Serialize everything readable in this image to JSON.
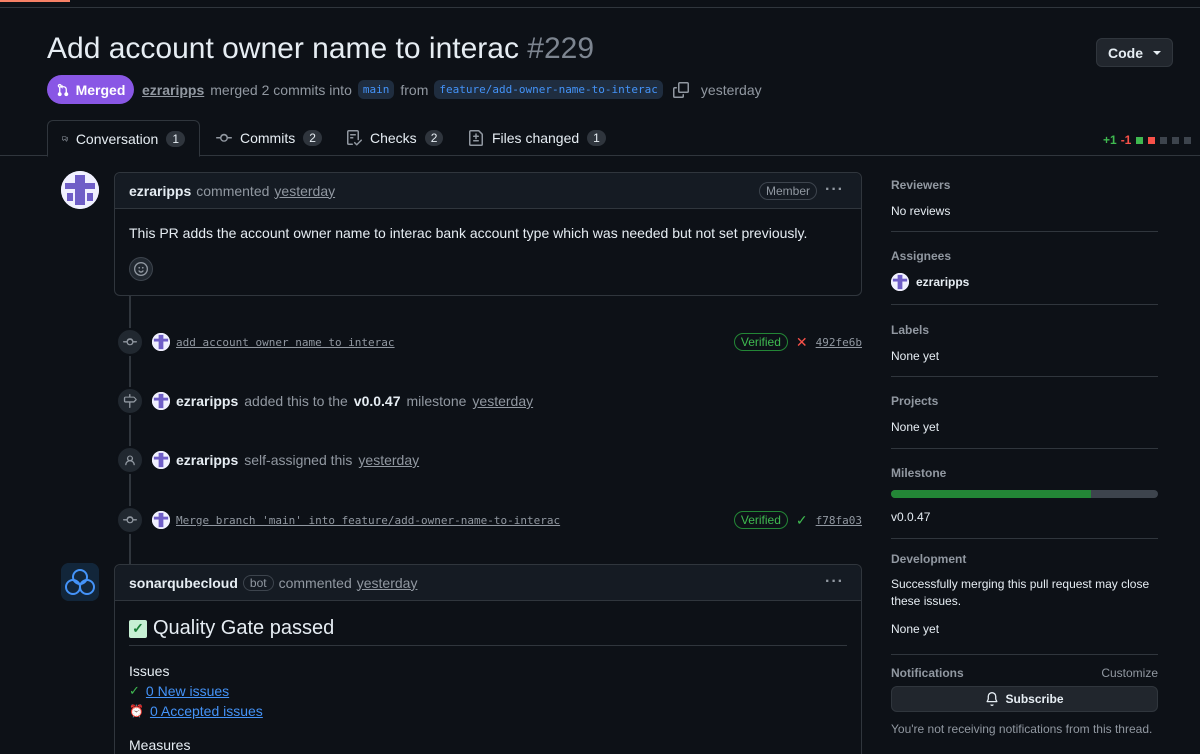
{
  "pr": {
    "title": "Add account owner name to interac",
    "number": "#229",
    "code_button": "Code",
    "status": "Merged",
    "author": "ezraripps",
    "merge_text": "merged 2 commits into",
    "base_branch": "main",
    "from_text": "from",
    "head_branch": "feature/add-owner-name-to-interac",
    "time": "yesterday"
  },
  "tabs": [
    {
      "label": "Conversation",
      "count": "1"
    },
    {
      "label": "Commits",
      "count": "2"
    },
    {
      "label": "Checks",
      "count": "2"
    },
    {
      "label": "Files changed",
      "count": "1"
    }
  ],
  "diffstat": {
    "additions": "+1",
    "deletions": "-1"
  },
  "comment1": {
    "author": "ezraripps",
    "action": "commented",
    "time": "yesterday",
    "badge": "Member",
    "body": "This PR adds the account owner name to interac bank account type which was needed but not set previously."
  },
  "events": {
    "commit1": {
      "message": "add account owner name to interac",
      "verified": "Verified",
      "sha": "492fe6b"
    },
    "milestone": {
      "author": "ezraripps",
      "text": "added this to the",
      "milestone": "v0.0.47",
      "suffix": "milestone",
      "time": "yesterday"
    },
    "assign": {
      "author": "ezraripps",
      "text": "self-assigned this",
      "time": "yesterday"
    },
    "commit2": {
      "message": "Merge branch 'main' into feature/add-owner-name-to-interac",
      "verified": "Verified",
      "sha": "f78fa03"
    }
  },
  "comment2": {
    "author": "sonarqubecloud",
    "badge": "bot",
    "action": "commented",
    "time": "yesterday",
    "heading": "Quality Gate passed",
    "issues_label": "Issues",
    "new_issues": "0 New issues",
    "accepted_issues": "0 Accepted issues",
    "measures_label": "Measures"
  },
  "sidebar": {
    "reviewers": {
      "title": "Reviewers",
      "value": "No reviews"
    },
    "assignees": {
      "title": "Assignees",
      "value": "ezraripps"
    },
    "labels": {
      "title": "Labels",
      "value": "None yet"
    },
    "projects": {
      "title": "Projects",
      "value": "None yet"
    },
    "milestone": {
      "title": "Milestone",
      "value": "v0.0.47",
      "progress": 0.75
    },
    "development": {
      "title": "Development",
      "text": "Successfully merging this pull request may close these issues.",
      "value": "None yet"
    },
    "notifications": {
      "title": "Notifications",
      "customize": "Customize",
      "subscribe": "Subscribe",
      "note": "You're not receiving notifications from this thread."
    }
  },
  "colors": {
    "merged": "#8957e5",
    "accent_blue": "#4493f8",
    "success": "#3fb950",
    "danger": "#f85149"
  }
}
